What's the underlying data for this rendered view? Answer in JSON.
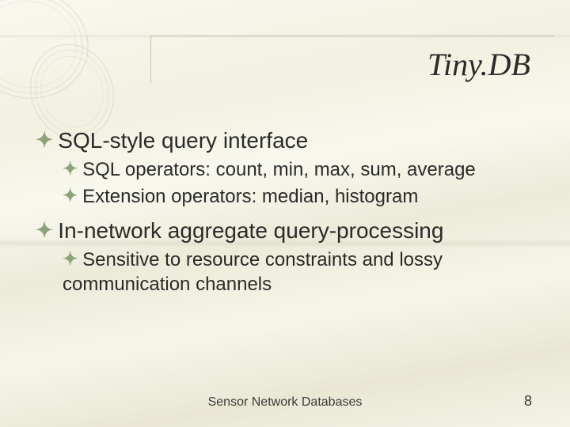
{
  "title": "Tiny.DB",
  "bullets": [
    {
      "level": 1,
      "text": "SQL-style query interface"
    },
    {
      "level": 2,
      "text": "SQL operators: count, min, max, sum, average"
    },
    {
      "level": 2,
      "text": "Extension operators: median, histogram"
    },
    {
      "level": 1,
      "text": "In-network aggregate query-processing"
    },
    {
      "level": 2,
      "text": "Sensitive to resource constraints and lossy communication channels"
    }
  ],
  "footer_center": "Sensor Network Databases",
  "footer_right": "8"
}
